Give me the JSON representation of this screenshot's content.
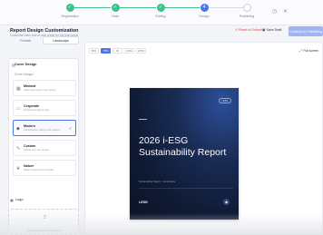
{
  "stepper": {
    "steps": [
      {
        "label": "Registration",
        "state": "done",
        "mark": "✓"
      },
      {
        "label": "Data",
        "state": "done",
        "mark": "✓"
      },
      {
        "label": "Editing",
        "state": "done",
        "mark": "✓"
      },
      {
        "label": "Design",
        "state": "current",
        "mark": "4"
      },
      {
        "label": "Publishing",
        "state": "todo",
        "mark": ""
      }
    ]
  },
  "header": {
    "title": "Report Design Customization",
    "subtitle": "Customize each look of your report for the best result",
    "reset_label": "↺ Reset to Default",
    "save_label": "Save Draft",
    "continue_label": "Continue to Publishing"
  },
  "left_panel": {
    "orientation_tabs": [
      "Portrait",
      "Landscape"
    ],
    "card_title": "Cover Design",
    "section_label": "Cover Designs",
    "options": [
      {
        "name": "Minimal",
        "desc": "Clean and simple cover design",
        "icon": "grid-icon",
        "selected": false
      },
      {
        "name": "Corporate",
        "desc": "Professional layout style",
        "icon": "briefcase-icon",
        "selected": false
      },
      {
        "name": "Modern",
        "desc": "Contemporary design with gradient",
        "icon": "layers-icon",
        "selected": true
      },
      {
        "name": "Custom",
        "desc": "Upload your own design",
        "icon": "brush-icon",
        "selected": false
      },
      {
        "name": "Nature",
        "desc": "Nature-inspired eco template",
        "icon": "leaf-icon",
        "selected": false
      }
    ],
    "custom_link": "Click Upload to create a matching option",
    "logo_label": "Logo",
    "upload_text": "Drag and drop your logo here"
  },
  "preview": {
    "zoom_levels": [
      "50%",
      "75%",
      "Fit",
      "100%",
      "125%"
    ],
    "active_zoom": "75%",
    "fullscreen_label": "Full screen",
    "cover": {
      "pill": "i-ESG",
      "title": "2026 i-ESG Sustainability Report",
      "meta": "Sustainability Report · Governance",
      "logo": "i-ESG",
      "badge": "◆"
    }
  },
  "colors": {
    "accent": "#4a74e8",
    "done": "#3ec28a",
    "cover_bg": "#0f1a33",
    "danger": "#e0483f"
  }
}
